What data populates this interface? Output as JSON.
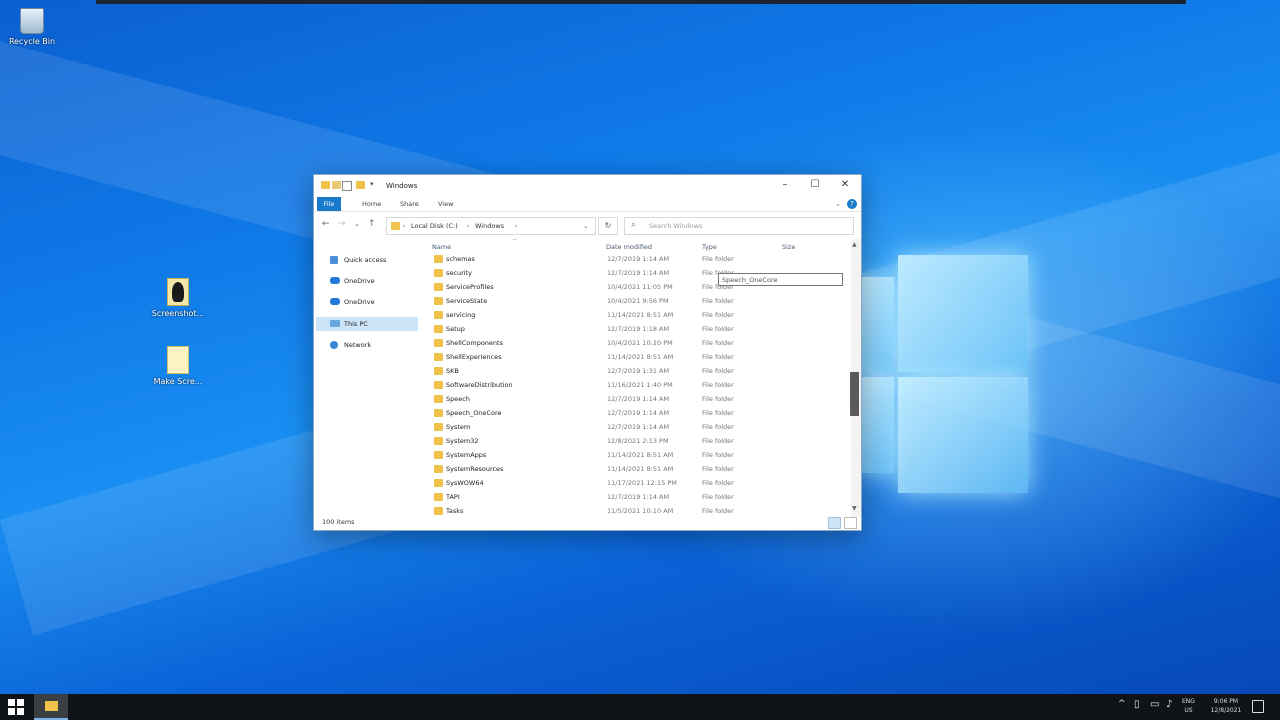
{
  "desktop": {
    "icons": [
      {
        "label": "Recycle Bin",
        "kind": "recycle-bin"
      },
      {
        "label": "Screenshot...",
        "kind": "shortcut"
      },
      {
        "label": "Make Scre...",
        "kind": "document"
      }
    ]
  },
  "window": {
    "title": "Windows",
    "ribbon_tabs": [
      "File",
      "Home",
      "Share",
      "View"
    ],
    "address": {
      "crumbs": [
        "Local Disk (C:)",
        "Windows"
      ]
    },
    "search_placeholder": "Search Windows",
    "nav": [
      {
        "label": "Quick access",
        "icon": "star-icon",
        "selected": false
      },
      {
        "label": "OneDrive",
        "icon": "cloud-icon",
        "selected": false
      },
      {
        "label": "OneDrive",
        "icon": "cloud-icon",
        "selected": false
      },
      {
        "label": "This PC",
        "icon": "computer-icon",
        "selected": true
      },
      {
        "label": "Network",
        "icon": "network-icon",
        "selected": false
      }
    ],
    "columns": {
      "name": "Name",
      "date": "Date modified",
      "type": "Type",
      "size": "Size"
    },
    "rows": [
      {
        "name": "schemas",
        "date": "12/7/2019 1:14 AM",
        "type": "File folder"
      },
      {
        "name": "security",
        "date": "12/7/2019 1:14 AM",
        "type": "File folder"
      },
      {
        "name": "ServiceProfiles",
        "date": "10/4/2021 11:05 PM",
        "type": "File folder"
      },
      {
        "name": "ServiceState",
        "date": "10/4/2021 9:56 PM",
        "type": "File folder"
      },
      {
        "name": "servicing",
        "date": "11/14/2021 8:51 AM",
        "type": "File folder"
      },
      {
        "name": "Setup",
        "date": "12/7/2019 1:18 AM",
        "type": "File folder"
      },
      {
        "name": "ShellComponents",
        "date": "10/4/2021 10:20 PM",
        "type": "File folder"
      },
      {
        "name": "ShellExperiences",
        "date": "11/14/2021 8:51 AM",
        "type": "File folder"
      },
      {
        "name": "SKB",
        "date": "12/7/2019 1:31 AM",
        "type": "File folder"
      },
      {
        "name": "SoftwareDistribution",
        "date": "11/16/2021 1:40 PM",
        "type": "File folder"
      },
      {
        "name": "Speech",
        "date": "12/7/2019 1:14 AM",
        "type": "File folder"
      },
      {
        "name": "Speech_OneCore",
        "date": "12/7/2019 1:14 AM",
        "type": "File folder"
      },
      {
        "name": "System",
        "date": "12/7/2019 1:14 AM",
        "type": "File folder"
      },
      {
        "name": "System32",
        "date": "12/8/2021 2:13 PM",
        "type": "File folder"
      },
      {
        "name": "SystemApps",
        "date": "11/14/2021 8:51 AM",
        "type": "File folder"
      },
      {
        "name": "SystemResources",
        "date": "11/14/2021 8:51 AM",
        "type": "File folder"
      },
      {
        "name": "SysWOW64",
        "date": "11/17/2021 12:15 PM",
        "type": "File folder"
      },
      {
        "name": "TAPI",
        "date": "12/7/2019 1:14 AM",
        "type": "File folder"
      },
      {
        "name": "Tasks",
        "date": "11/5/2021 10:10 AM",
        "type": "File folder"
      }
    ],
    "tooltip": "Speech_OneCore",
    "status": "100 items"
  },
  "taskbar": {
    "lang": [
      "ENG",
      "US"
    ],
    "time": "9:06 PM",
    "date": "12/8/2021"
  }
}
